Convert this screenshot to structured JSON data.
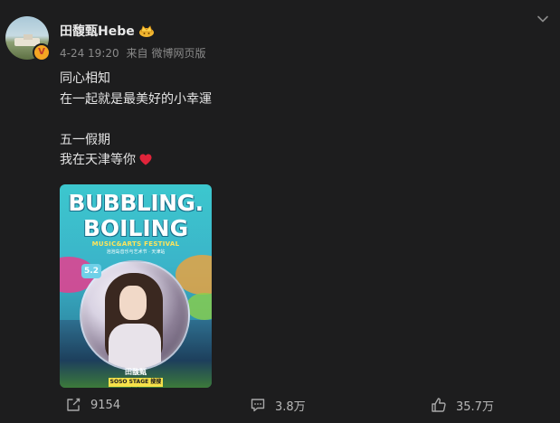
{
  "post": {
    "username": "田馥甄Hebe",
    "timestamp": "4-24 19:20",
    "source_prefix": "来自",
    "source": "微博网页版",
    "text_lines": [
      "同心相知",
      "在一起就是最美好的小幸運",
      "",
      "五一假期",
      "我在天津等你"
    ],
    "poster": {
      "title_line1": "BUBBLING.",
      "title_line2": "BOILING",
      "subtitle": "MUSIC&ARTS FESTIVAL",
      "subtitle_cn": "泡泡岛音乐与艺术节 · 天津站",
      "date": "5.2",
      "artist": "田馥甄",
      "stage": "SOSO STAGE 搜搜舞台"
    }
  },
  "actions": {
    "repost_count": "9154",
    "comment_count": "3.8万",
    "like_count": "35.7万"
  },
  "icons": {
    "verified": "verified-v-badge-icon",
    "member": "crown-icon",
    "heart": "red-heart-icon",
    "menu": "chevron-down-icon",
    "repost": "repost-icon",
    "comment": "comment-icon",
    "like": "thumbs-up-icon"
  },
  "colors": {
    "background": "#1d1d1e",
    "text": "#e4e4e4",
    "meta": "#8a8a8a",
    "heart": "#e0243a",
    "badge": "#f5a623"
  }
}
